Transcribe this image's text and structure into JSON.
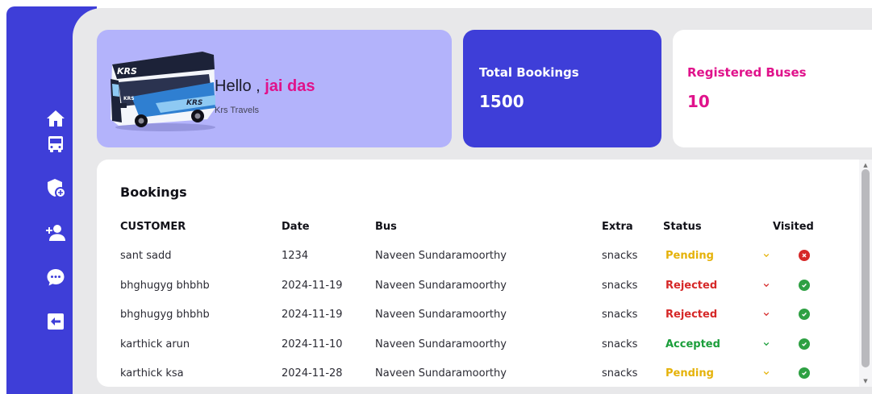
{
  "sidebar": {
    "items": [
      {
        "icon": "home-icon"
      },
      {
        "icon": "bus-icon"
      },
      {
        "icon": "shield-plus-icon"
      },
      {
        "icon": "add-user-icon"
      },
      {
        "icon": "chat-icon"
      },
      {
        "icon": "logout-icon"
      }
    ]
  },
  "welcome": {
    "greeting": "Hello , ",
    "user_name": "jai das",
    "company": "Krs Travels",
    "bus_logo_text": "KRS"
  },
  "stats": {
    "total_bookings": {
      "label": "Total Bookings",
      "value": "1500"
    },
    "registered_buses": {
      "label": "Registered Buses",
      "value": "10"
    }
  },
  "bookings": {
    "title": "Bookings",
    "columns": {
      "customer": "CUSTOMER",
      "date": "Date",
      "bus": "Bus",
      "extra": "Extra",
      "status": "Status",
      "visited": "Visited"
    },
    "rows": [
      {
        "customer": "sant sadd",
        "date": "1234",
        "bus": "Naveen Sundaramoorthy",
        "extra": "snacks",
        "status": "Pending",
        "visited": false
      },
      {
        "customer": "bhghugyg bhbhb",
        "date": "2024-11-19",
        "bus": "Naveen Sundaramoorthy",
        "extra": "snacks",
        "status": "Rejected",
        "visited": true
      },
      {
        "customer": "bhghugyg bhbhb",
        "date": "2024-11-19",
        "bus": "Naveen Sundaramoorthy",
        "extra": "snacks",
        "status": "Rejected",
        "visited": true
      },
      {
        "customer": "karthick arun",
        "date": "2024-11-10",
        "bus": "Naveen Sundaramoorthy",
        "extra": "snacks",
        "status": "Accepted",
        "visited": true
      },
      {
        "customer": "karthick ksa",
        "date": "2024-11-28",
        "bus": "Naveen Sundaramoorthy",
        "extra": "snacks",
        "status": "Pending",
        "visited": true
      }
    ]
  },
  "colors": {
    "primary": "#3e3ed8",
    "accent": "#e0128b",
    "card_lavender": "#b3b3fb",
    "panel_bg": "#e8e8ea",
    "pending": "#e5b20a",
    "rejected": "#d62828",
    "accepted": "#1a9e3a",
    "visited_yes": "#2ea043",
    "visited_no": "#d62828"
  }
}
